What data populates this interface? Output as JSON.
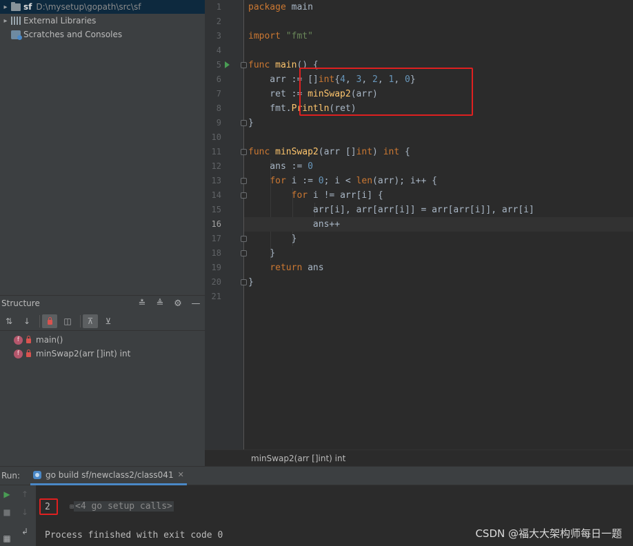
{
  "project_tree": {
    "items": [
      {
        "name": "sf",
        "path": "D:\\mysetup\\gopath\\src\\sf",
        "icon": "folder-icon"
      },
      {
        "name": "External Libraries",
        "icon": "library-icon"
      },
      {
        "name": "Scratches and Consoles",
        "icon": "scratch-icon"
      }
    ]
  },
  "structure": {
    "title": "Structure",
    "items": [
      {
        "badge": "f",
        "label": "main()"
      },
      {
        "badge": "f",
        "label": "minSwap2(arr []int) int"
      }
    ]
  },
  "editor": {
    "line_numbers": [
      "1",
      "2",
      "3",
      "4",
      "5",
      "6",
      "7",
      "8",
      "9",
      "10",
      "11",
      "12",
      "13",
      "14",
      "15",
      "16",
      "17",
      "18",
      "19",
      "20",
      "21"
    ],
    "current_line": 16
  },
  "breadcrumb": "minSwap2(arr []int) int",
  "run": {
    "label": "Run:",
    "tab_title": "go build sf/newclass2/class041",
    "setup_calls": "<4 go setup calls>",
    "output": "2",
    "finished": "Process finished with exit code 0"
  },
  "watermark": "CSDN @福大大架构师每日一题",
  "colors": {
    "keyword": "#cc7832",
    "string": "#6a8759",
    "number": "#6897bb",
    "function": "#ffc66d",
    "highlight_box": "#e02020"
  }
}
